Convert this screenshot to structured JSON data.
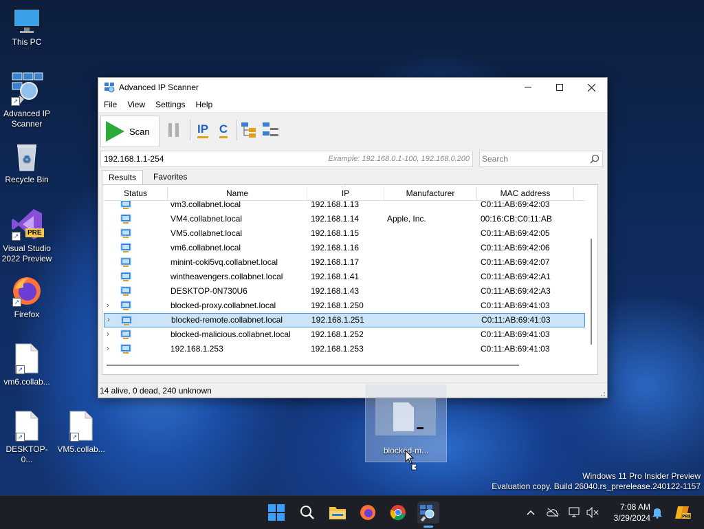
{
  "desktop": {
    "icons": [
      {
        "label": "This PC"
      },
      {
        "label": "Advanced IP Scanner"
      },
      {
        "label": "Recycle Bin"
      },
      {
        "label": "Visual Studio 2022 Preview"
      },
      {
        "label": "Firefox"
      },
      {
        "label": "vm6.collab..."
      },
      {
        "label": "DESKTOP-0..."
      },
      {
        "label": "VM5.collab..."
      }
    ],
    "drag_ghost_label": "blocked-m...",
    "vs_badge": "PRE"
  },
  "window": {
    "title": "Advanced IP Scanner",
    "menu": [
      "File",
      "View",
      "Settings",
      "Help"
    ],
    "toolbar": {
      "scan_label": "Scan",
      "ip_label": "IP",
      "c_label": "C"
    },
    "ip_range_value": "192.168.1.1-254",
    "ip_range_example": "Example: 192.168.0.1-100, 192.168.0.200",
    "search_placeholder": "Search",
    "tabs": [
      "Results",
      "Favorites"
    ],
    "columns": [
      "Status",
      "Name",
      "IP",
      "Manufacturer",
      "MAC address"
    ],
    "sort_indicator": "^",
    "rows": [
      {
        "name": "vm3.collabnet.local",
        "ip": "192.168.1.13",
        "manufacturer": "",
        "mac": "C0:11:AB:69:42:03",
        "expandable": false,
        "selected": false
      },
      {
        "name": "VM4.collabnet.local",
        "ip": "192.168.1.14",
        "manufacturer": "Apple, Inc.",
        "mac": "00:16:CB:C0:11:AB",
        "expandable": false,
        "selected": false
      },
      {
        "name": "VM5.collabnet.local",
        "ip": "192.168.1.15",
        "manufacturer": "",
        "mac": "C0:11:AB:69:42:05",
        "expandable": false,
        "selected": false
      },
      {
        "name": "vm6.collabnet.local",
        "ip": "192.168.1.16",
        "manufacturer": "",
        "mac": "C0:11:AB:69:42:06",
        "expandable": false,
        "selected": false
      },
      {
        "name": "minint-coki5vq.collabnet.local",
        "ip": "192.168.1.17",
        "manufacturer": "",
        "mac": "C0:11:AB:69:42:07",
        "expandable": false,
        "selected": false
      },
      {
        "name": "wintheavengers.collabnet.local",
        "ip": "192.168.1.41",
        "manufacturer": "",
        "mac": "C0:11:AB:69:42:A1",
        "expandable": false,
        "selected": false
      },
      {
        "name": "DESKTOP-0N730U6",
        "ip": "192.168.1.43",
        "manufacturer": "",
        "mac": "C0:11:AB:69:42:A3",
        "expandable": false,
        "selected": false
      },
      {
        "name": "blocked-proxy.collabnet.local",
        "ip": "192.168.1.250",
        "manufacturer": "",
        "mac": "C0:11:AB:69:41:03",
        "expandable": true,
        "selected": false
      },
      {
        "name": "blocked-remote.collabnet.local",
        "ip": "192.168.1.251",
        "manufacturer": "",
        "mac": "C0:11:AB:69:41:03",
        "expandable": true,
        "selected": true
      },
      {
        "name": "blocked-malicious.collabnet.local",
        "ip": "192.168.1.252",
        "manufacturer": "",
        "mac": "C0:11:AB:69:41:03",
        "expandable": true,
        "selected": false
      },
      {
        "name": "192.168.1.253",
        "ip": "192.168.1.253",
        "manufacturer": "",
        "mac": "C0:11:AB:69:41:03",
        "expandable": true,
        "selected": false
      }
    ],
    "status_text": "14 alive, 0 dead, 240 unknown"
  },
  "watermark": {
    "line1": "Windows 11 Pro Insider Preview",
    "line2": "Evaluation copy. Build 26040.rs_prerelease.240122-1157"
  },
  "taskbar": {
    "apps": [
      "start-icon",
      "search-icon",
      "file-explorer-icon",
      "firefox-icon",
      "chrome-icon",
      "advanced-ip-scanner-icon"
    ],
    "time": "7:08 AM",
    "date": "3/29/2024"
  },
  "colors": {
    "selection": "#cce4f7",
    "selection_border": "#4a90d9",
    "taskbar": "#1c1f26",
    "scan_green": "#2eaa3a"
  }
}
